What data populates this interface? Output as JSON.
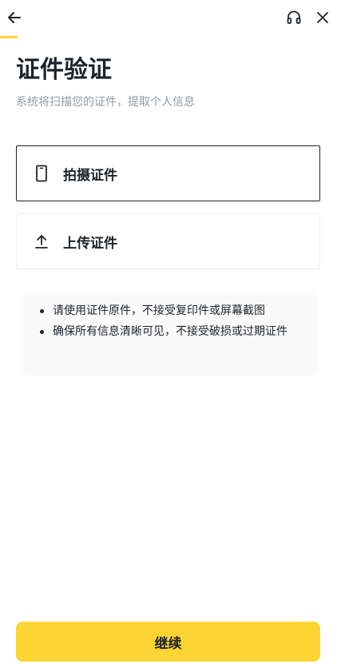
{
  "header": {
    "back_icon": "arrow-left-icon",
    "support_icon": "headset-icon",
    "close_icon": "close-icon",
    "progress_color": "#fcd535"
  },
  "title": "证件验证",
  "subtitle": "系统将扫描您的证件，提取个人信息",
  "options": [
    {
      "label": "拍摄证件",
      "icon": "phone-icon",
      "selected": true
    },
    {
      "label": "上传证件",
      "icon": "upload-icon",
      "selected": false
    }
  ],
  "tips": [
    "请使用证件原件，不接受复印件或屏幕截图",
    "确保所有信息清晰可见，不接受破损或过期证件"
  ],
  "continue_label": "继续",
  "colors": {
    "accent": "#fcd535",
    "text_primary": "#1e2329",
    "text_secondary": "#929aa5"
  }
}
